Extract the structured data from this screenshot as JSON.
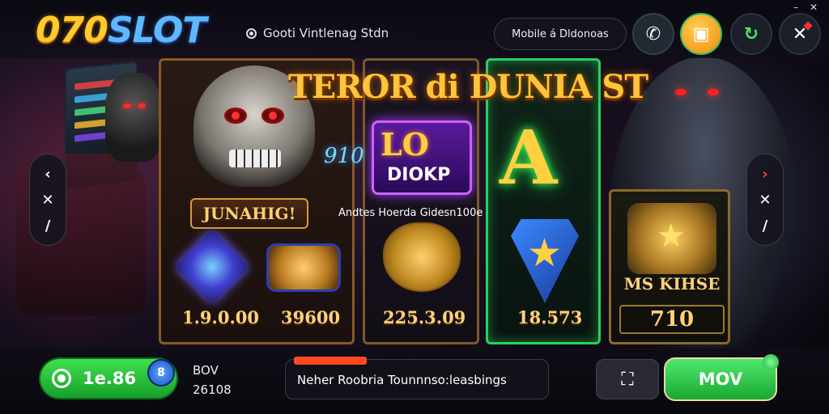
{
  "header": {
    "logo_num": "070",
    "logo_word": "SLOT",
    "status_text": "Gooti Vintlenag Stdn",
    "mobile_label": "Mobile á Dldonoas",
    "window_controls": [
      "–",
      "✕"
    ],
    "icons": [
      "phone-icon",
      "gift-icon",
      "refresh-icon",
      "close-icon"
    ]
  },
  "game": {
    "title": "TEROR di DUNIA ST",
    "reel1": {
      "badge": "JUNAHIG!",
      "value_a": "1.9.0.00",
      "value_b": "39600"
    },
    "reel2": {
      "symbol_big": "LO",
      "symbol_small": "DIOKP",
      "floating_number": "910",
      "value": "225.3.09"
    },
    "reel3": {
      "symbol": "A",
      "value": "18.573"
    },
    "reel4": {
      "label": "MS KIHSE",
      "value": "710"
    },
    "caption": "Andtes Hoerda Gidesn100e"
  },
  "side_nav": {
    "left": [
      "‹",
      "✕",
      "/"
    ],
    "right": [
      "›",
      "✕",
      "/"
    ]
  },
  "footer": {
    "balance": "1e.86",
    "coin_label": "8",
    "bov_line1": "BOV",
    "bov_line2": "26108",
    "ticker_text": "Neher Roobria Tounnnso:leasbings",
    "spin_label": "MOV",
    "chat_icon": "chat-icon"
  },
  "colors": {
    "accent_gold": "#ffc43a",
    "accent_green": "#30c040",
    "accent_blue": "#5fb8ff"
  }
}
